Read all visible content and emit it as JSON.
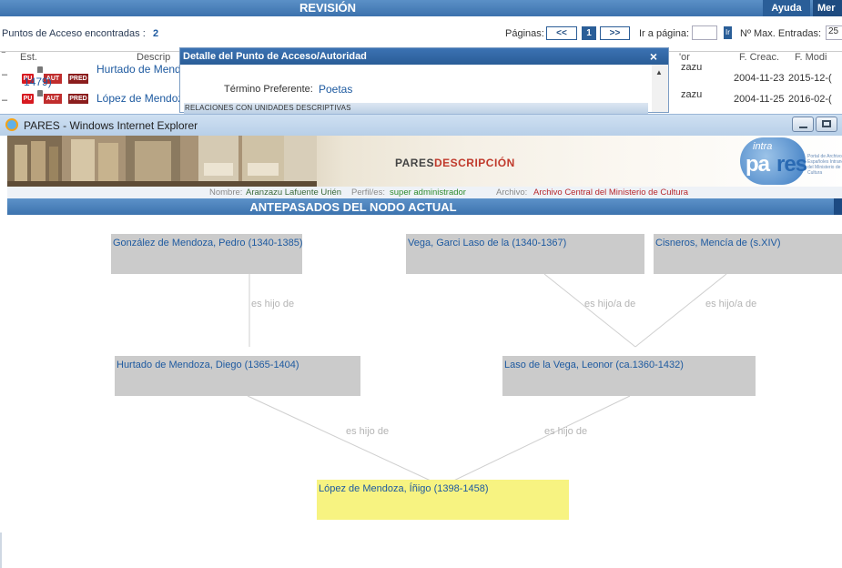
{
  "background_page": {
    "header_title": "REVISIÓN",
    "help_button": "Ayuda",
    "menu_button": "Mer",
    "found_label": "Puntos de Acceso encontradas :",
    "found_count": "2",
    "pages_label": "Páginas:",
    "prev_button": "<<",
    "current_page": "1",
    "next_button": ">>",
    "goto_label": "Ir a página:",
    "goto_button": "Ir",
    "max_entries_label": "Nº Max. Entradas:",
    "max_entries_value": "25",
    "columns": {
      "est": "Est.",
      "descr": "Descrip",
      "by": "'or",
      "created": "F. Creac.",
      "modified": "F. Modi"
    },
    "rows": [
      {
        "description_line1": "Hurtado de Mendo",
        "description_line2": "1479)",
        "by": "zazu",
        "created": "2004-11-23",
        "modified": "2015-12-("
      },
      {
        "description_line1": "López de Mendoza",
        "by": "zazu",
        "created": "2004-11-25",
        "modified": "2016-02-("
      }
    ],
    "badges": {
      "pu": "PU",
      "aut": "AUT",
      "pred": "PRED"
    }
  },
  "popup": {
    "title": "Detalle del Punto de Acceso/Autoridad",
    "close_symbol": "×",
    "term_label": "Término Preferente:",
    "term_value": "Poetas",
    "relations_bar": "RELACIONES CON UNIDADES DESCRIPTIVAS"
  },
  "ie_window": {
    "title": "PARES - Windows Internet Explorer"
  },
  "banner": {
    "title_part1": "PARES",
    "title_part2": "DESCRIPCIÓN",
    "logo_intra": "intra",
    "logo_pa": "pa",
    "logo_res": "res",
    "logo_caption": "Portal de Archivos Españoles Intranet del Ministerio de Cultura"
  },
  "user_bar": {
    "name_label": "Nombre:",
    "name_value": "Aranzazu Lafuente Urién",
    "perfil_label": "Perfil/es:",
    "perfil_value": "super administrador",
    "archivo_label": "Archivo:",
    "archivo_value": "Archivo Central del Ministerio de Cultura"
  },
  "tree": {
    "title": "ANTEPASADOS DEL NODO ACTUAL",
    "nodes": {
      "gonzalez": "González de Mendoza, Pedro (1340-1385)",
      "garci": "Vega, Garci Laso de la (1340-1367)",
      "cisneros": "Cisneros, Mencía de (s.XIV)",
      "hurtado": "Hurtado de Mendoza, Diego (1365-1404)",
      "laso": "Laso de la Vega, Leonor (ca.1360-1432)",
      "lopez": "López de Mendoza, Íñigo (1398-1458)"
    },
    "relations": {
      "r1": "es hijo de",
      "r2": "es hijo/a de",
      "r3": "es hijo/a de",
      "r4": "es hijo de",
      "r5": "es hijo de"
    }
  },
  "colors": {
    "header_blue": "#3c72ad",
    "node_gray": "#cbcbcb",
    "current_node_yellow": "#f7f381",
    "link_blue": "#1e5aa0"
  }
}
